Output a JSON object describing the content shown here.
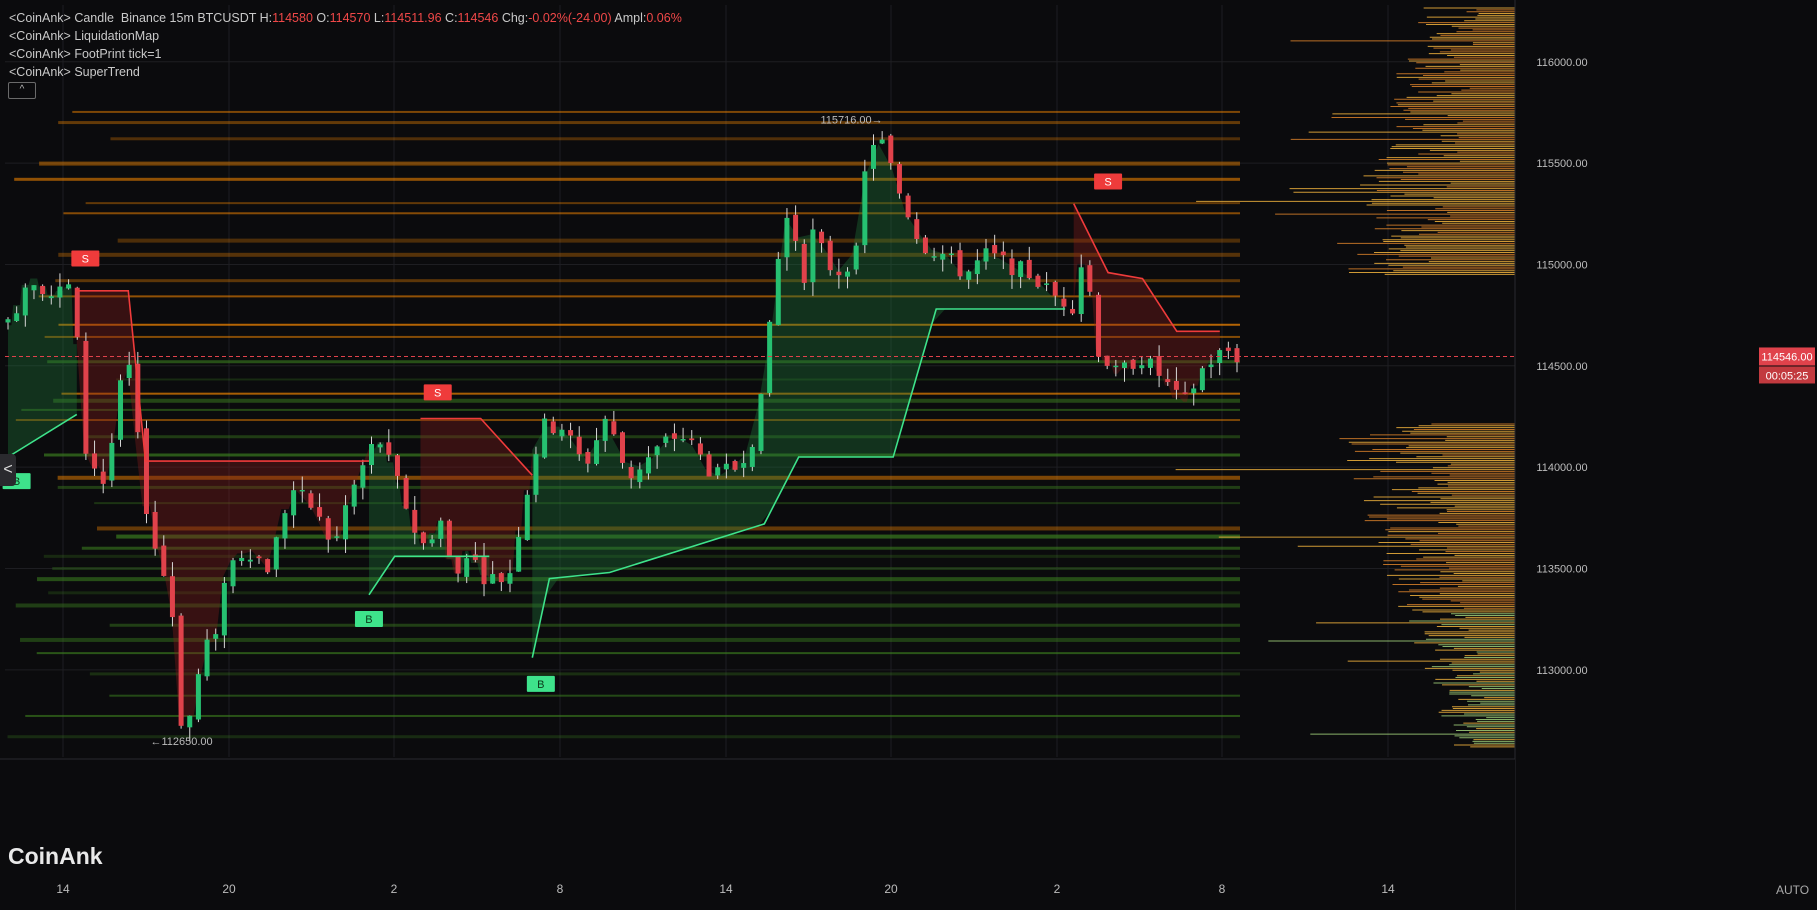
{
  "legend": {
    "candle": {
      "name": "<CoinAnk> Candle",
      "exchange": "Binance 15m BTCUSDT",
      "h_label": "H:",
      "h_value": "114580",
      "o_label": "O:",
      "o_value": "114570",
      "l_label": "L:",
      "l_value": "114511.96",
      "c_label": "C:",
      "c_value": "114546",
      "chg_label": "Chg:",
      "chg_value": "-0.02%(-24.00)",
      "ampl_label": "Ampl:",
      "ampl_value": "0.06%"
    },
    "liquidation": "<CoinAnk> LiquidationMap",
    "footprint": "<CoinAnk> FootPrint    tick=1",
    "supertrend": "<CoinAnk> SuperTrend",
    "collapse_label": "^"
  },
  "side_arrow": "<",
  "watermark": "CoinAnk",
  "auto_label": "AUTO",
  "colors": {
    "background": "#0b0b0d",
    "up": "#26c071",
    "down": "#e0424b",
    "supertrend_up": "#3ee38b",
    "supertrend_down": "#ef3b3b",
    "liquidation_orange": "#ff8c00",
    "liquidation_green": "#3b7d1f",
    "last_price": "#e0424b"
  },
  "chart_data": {
    "type": "candlestick",
    "symbol": "BTCUSDT",
    "exchange": "Binance",
    "interval": "15m",
    "y_range": [
      112570,
      116280
    ],
    "y_ticks": [
      "116000.00",
      "115500.00",
      "115000.00",
      "114500.00",
      "114000.00",
      "113500.00",
      "113000.00"
    ],
    "x_ticks": [
      "14",
      "20",
      "2",
      "8",
      "14",
      "20",
      "2",
      "8",
      "14"
    ],
    "last_price": "114546.00",
    "countdown": "00:05:25",
    "high_label": "115716.00",
    "low_label": "112650.00",
    "price_path": [
      [
        0,
        114700
      ],
      [
        2,
        114950
      ],
      [
        4,
        114850
      ],
      [
        6,
        114900
      ],
      [
        7,
        114100
      ],
      [
        9,
        113900
      ],
      [
        10,
        114300
      ],
      [
        11,
        114550
      ],
      [
        12,
        114100
      ],
      [
        13,
        113700
      ],
      [
        15,
        113350
      ],
      [
        16,
        112700
      ],
      [
        17,
        112800
      ],
      [
        18,
        113150
      ],
      [
        19,
        113100
      ],
      [
        20,
        113500
      ],
      [
        22,
        113600
      ],
      [
        24,
        113500
      ],
      [
        26,
        113900
      ],
      [
        28,
        113800
      ],
      [
        30,
        113600
      ],
      [
        31,
        113800
      ],
      [
        33,
        114050
      ],
      [
        34,
        114150
      ],
      [
        36,
        113900
      ],
      [
        38,
        113600
      ],
      [
        40,
        113750
      ],
      [
        41,
        113400
      ],
      [
        42,
        113600
      ],
      [
        44,
        113450
      ],
      [
        46,
        113450
      ],
      [
        47,
        113700
      ],
      [
        49,
        114200
      ],
      [
        51,
        114200
      ],
      [
        53,
        114000
      ],
      [
        55,
        114250
      ],
      [
        57,
        113950
      ],
      [
        59,
        114050
      ],
      [
        61,
        114150
      ],
      [
        62,
        114150
      ],
      [
        63,
        114100
      ],
      [
        65,
        113950
      ],
      [
        67,
        114000
      ],
      [
        69,
        114200
      ],
      [
        70,
        114700
      ],
      [
        71,
        115100
      ],
      [
        72,
        115300
      ],
      [
        73,
        114900
      ],
      [
        74,
        115150
      ],
      [
        76,
        114950
      ],
      [
        78,
        115050
      ],
      [
        79,
        115550
      ],
      [
        80,
        115650
      ],
      [
        82,
        115350
      ],
      [
        84,
        115100
      ],
      [
        86,
        115050
      ],
      [
        88,
        114950
      ],
      [
        90,
        115050
      ],
      [
        92,
        115000
      ],
      [
        94,
        114950
      ],
      [
        96,
        114850
      ],
      [
        98,
        114800
      ],
      [
        99,
        115100
      ],
      [
        100,
        114600
      ],
      [
        102,
        114450
      ],
      [
        104,
        114550
      ],
      [
        106,
        114450
      ],
      [
        108,
        114300
      ],
      [
        110,
        114500
      ],
      [
        112,
        114580
      ],
      [
        113,
        114546
      ]
    ],
    "supertrend_segments": [
      {
        "dir": "up",
        "points": [
          [
            0,
            114050
          ],
          [
            8,
            114260
          ]
        ]
      },
      {
        "dir": "down",
        "points": [
          [
            8,
            114870
          ],
          [
            14,
            114870
          ],
          [
            16,
            114030
          ],
          [
            42,
            114030
          ]
        ]
      },
      {
        "dir": "up",
        "points": [
          [
            42,
            113370
          ],
          [
            45,
            113560
          ],
          [
            56,
            113560
          ]
        ]
      },
      {
        "dir": "down",
        "points": [
          [
            48,
            114240
          ],
          [
            55,
            114240
          ],
          [
            61,
            113960
          ]
        ]
      },
      {
        "dir": "up",
        "points": [
          [
            61,
            113060
          ],
          [
            63,
            113450
          ],
          [
            70,
            113480
          ],
          [
            88,
            113720
          ],
          [
            92,
            114050
          ],
          [
            103,
            114050
          ],
          [
            108,
            114780
          ],
          [
            123,
            114780
          ]
        ]
      },
      {
        "dir": "down",
        "points": [
          [
            124,
            115300
          ],
          [
            128,
            114960
          ],
          [
            132,
            114930
          ],
          [
            136,
            114670
          ],
          [
            141,
            114670
          ]
        ]
      }
    ],
    "signals": [
      {
        "type": "B",
        "label": "B",
        "x": 1,
        "y": 114000
      },
      {
        "type": "S",
        "label": "S",
        "x": 9,
        "y": 114960
      },
      {
        "type": "S",
        "label": "S",
        "x": 50,
        "y": 114300
      },
      {
        "type": "B",
        "label": "B",
        "x": 42,
        "y": 113320
      },
      {
        "type": "B",
        "label": "B",
        "x": 62,
        "y": 113000
      },
      {
        "type": "S",
        "label": "S",
        "x": 128,
        "y": 115340
      }
    ],
    "liquidation_heatmap_levels": [
      115750,
      115700,
      115620,
      115500,
      115420,
      115300,
      115250,
      115120,
      115050,
      114920,
      114840,
      114700,
      114640,
      114520,
      114430,
      114360,
      114330,
      114280,
      114230,
      114150,
      114060,
      113950,
      113900,
      113820,
      113700,
      113660,
      113600,
      113560,
      113500,
      113450,
      113380,
      113320,
      113220,
      113150,
      113080,
      112980,
      112870,
      112770,
      112670
    ],
    "grid": true,
    "legend_placement": "top-left"
  }
}
